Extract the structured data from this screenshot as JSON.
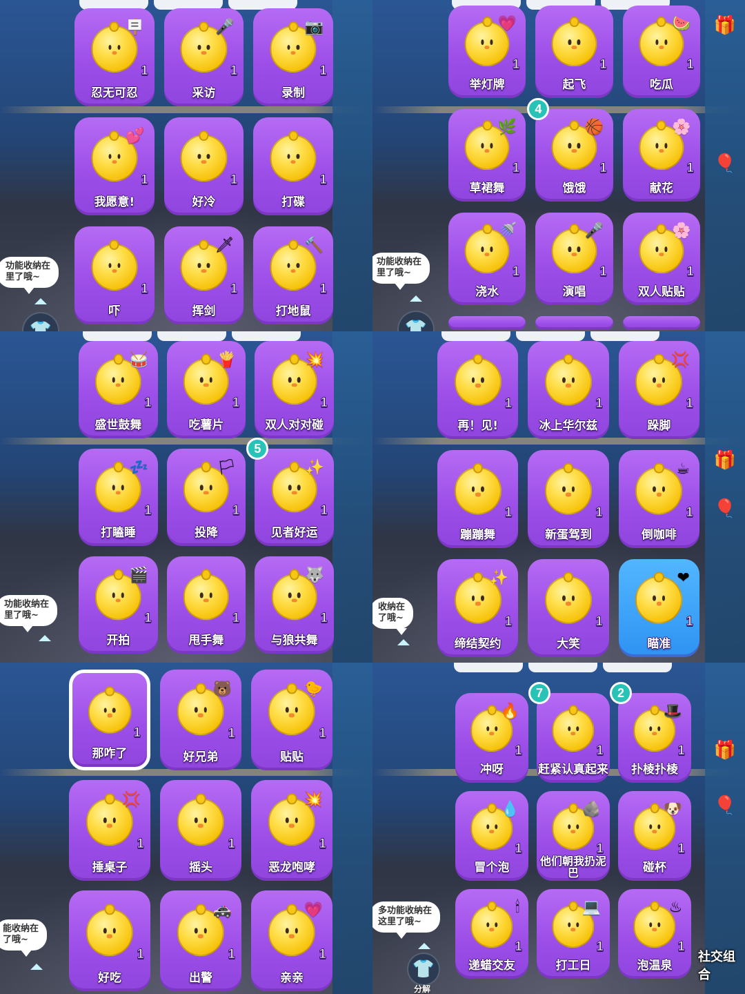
{
  "colors": {
    "card_purple": "#a85bef",
    "card_blue_selected": "#3ea5f8",
    "badge_teal": "#27c3b6",
    "label_outline": "#3b1470"
  },
  "panels": [
    {
      "tabs": [
        "",
        "",
        "",
        ""
      ],
      "bubble": "功能收纳在\n里了哦~",
      "items": [
        {
          "label": "忍无可忍",
          "count": "1",
          "prop": "🪧"
        },
        {
          "label": "采访",
          "count": "1",
          "prop": "🎤"
        },
        {
          "label": "录制",
          "count": "1",
          "prop": "📷"
        },
        {
          "label": "我愿意!",
          "count": "1",
          "prop": "💕"
        },
        {
          "label": "好冷",
          "count": "1",
          "prop": ""
        },
        {
          "label": "打碟",
          "count": "1",
          "prop": ""
        },
        {
          "label": "吓",
          "count": "1",
          "prop": ""
        },
        {
          "label": "挥剑",
          "count": "1",
          "prop": "🗡"
        },
        {
          "label": "打地鼠",
          "count": "1",
          "prop": "🔨"
        }
      ]
    },
    {
      "tabs": [
        "",
        "",
        "",
        ""
      ],
      "bubble": "功能收纳在\n里了哦~",
      "items": [
        {
          "label": "举灯牌",
          "count": "1",
          "prop": "💗"
        },
        {
          "label": "起飞",
          "count": "1",
          "prop": ""
        },
        {
          "label": "吃瓜",
          "count": "1",
          "prop": "🍉"
        },
        {
          "label": "草裙舞",
          "count": "1",
          "prop": "🌿"
        },
        {
          "label": "饿饿",
          "count": "1",
          "prop": "🏀",
          "badge": "4"
        },
        {
          "label": "献花",
          "count": "1",
          "prop": "🌸"
        },
        {
          "label": "浇水",
          "count": "1",
          "prop": "🚿"
        },
        {
          "label": "演唱",
          "count": "1",
          "prop": "🎤"
        },
        {
          "label": "双人贴贴",
          "count": "1",
          "prop": "🌸"
        }
      ]
    },
    {
      "tabs": [
        "",
        "",
        "",
        ""
      ],
      "bubble": "功能收纳在\n里了哦~",
      "items": [
        {
          "label": "盛世鼓舞",
          "count": "1",
          "prop": "🥁"
        },
        {
          "label": "吃薯片",
          "count": "1",
          "prop": "🍟"
        },
        {
          "label": "双人对对碰",
          "count": "1",
          "prop": "💥"
        },
        {
          "label": "打瞌睡",
          "count": "1",
          "prop": "💤"
        },
        {
          "label": "投降",
          "count": "1",
          "prop": "🏳"
        },
        {
          "label": "见者好运",
          "count": "1",
          "prop": "✨",
          "badge": "5"
        },
        {
          "label": "开拍",
          "count": "1",
          "prop": "🎬"
        },
        {
          "label": "甩手舞",
          "count": "1",
          "prop": ""
        },
        {
          "label": "与狼共舞",
          "count": "1",
          "prop": "🐺"
        }
      ]
    },
    {
      "tabs": [
        "",
        "",
        "",
        ""
      ],
      "bubble": "收纳在\n了哦~",
      "items": [
        {
          "label": "再！见!",
          "count": "1",
          "prop": ""
        },
        {
          "label": "冰上华尔兹",
          "count": "1",
          "prop": ""
        },
        {
          "label": "跺脚",
          "count": "1",
          "prop": "💢"
        },
        {
          "label": "蹦蹦舞",
          "count": "1",
          "prop": ""
        },
        {
          "label": "新蛋驾到",
          "count": "1",
          "prop": ""
        },
        {
          "label": "倒咖啡",
          "count": "1",
          "prop": "☕"
        },
        {
          "label": "缔结契约",
          "count": "1",
          "prop": "✨"
        },
        {
          "label": "大笑",
          "count": "1",
          "prop": ""
        },
        {
          "label": "瞄准",
          "count": "1",
          "prop": "❤",
          "selected": true
        }
      ]
    },
    {
      "tabs": [],
      "bubble": "能收纳在\n了哦~",
      "items": [
        {
          "label": "那咋了",
          "count": "1",
          "prop": "",
          "outlined": true
        },
        {
          "label": "好兄弟",
          "count": "1",
          "prop": "🐻"
        },
        {
          "label": "贴贴",
          "count": "1",
          "prop": "🐤"
        },
        {
          "label": "捶桌子",
          "count": "1",
          "prop": "💢"
        },
        {
          "label": "摇头",
          "count": "1",
          "prop": ""
        },
        {
          "label": "恶龙咆哮",
          "count": "1",
          "prop": "💥"
        },
        {
          "label": "好吃",
          "count": "1",
          "prop": ""
        },
        {
          "label": "出警",
          "count": "1",
          "prop": "🚓"
        },
        {
          "label": "亲亲",
          "count": "1",
          "prop": "💗"
        }
      ]
    },
    {
      "tabs": [
        "",
        "",
        "",
        ""
      ],
      "bubble": "多功能收纳在\n这里了哦~",
      "fab_label": "分解",
      "corner_text": "社交组合",
      "items": [
        {
          "label": "冲呀",
          "count": "1",
          "prop": "🔥"
        },
        {
          "label": "赶紧认真起来",
          "count": "1",
          "prop": "",
          "badge": "7"
        },
        {
          "label": "扑棱扑棱",
          "count": "1",
          "prop": "🎩",
          "badge": "2"
        },
        {
          "label": "冒个泡",
          "count": "1",
          "prop": "💧"
        },
        {
          "label": "他们朝我扔泥巴",
          "count": "1",
          "prop": "🪨",
          "wrap": true
        },
        {
          "label": "碰杯",
          "count": "1",
          "prop": "🐶"
        },
        {
          "label": "递蜡交友",
          "count": "1",
          "prop": "🕯"
        },
        {
          "label": "打工日",
          "count": "1",
          "prop": "💻"
        },
        {
          "label": "泡温泉",
          "count": "1",
          "prop": "♨"
        }
      ]
    }
  ]
}
